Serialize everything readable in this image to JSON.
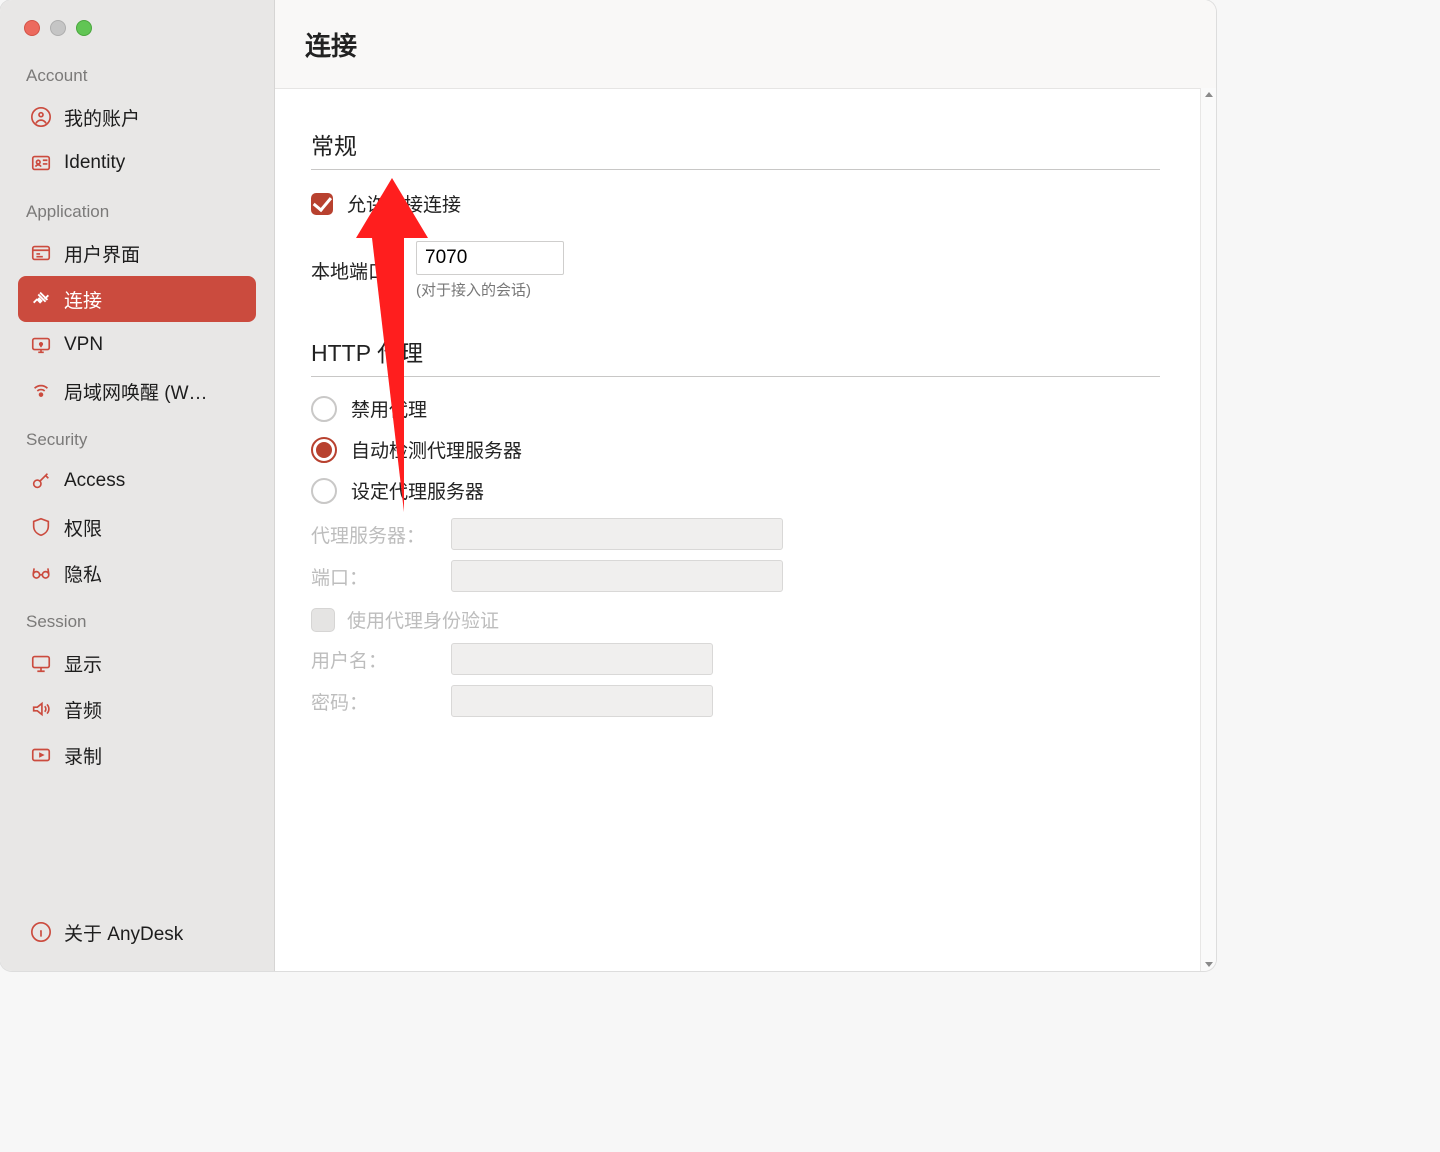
{
  "sidebar": {
    "sections": {
      "account": {
        "header": "Account",
        "items": [
          {
            "label": "我的账户",
            "icon": "user-circle"
          },
          {
            "label": "Identity",
            "icon": "id-card"
          }
        ]
      },
      "application": {
        "header": "Application",
        "items": [
          {
            "label": "用户界面",
            "icon": "ui"
          },
          {
            "label": "连接",
            "icon": "plug",
            "selected": true
          },
          {
            "label": "VPN",
            "icon": "vpn"
          },
          {
            "label": "局域网唤醒 (W…",
            "icon": "wol"
          }
        ]
      },
      "security": {
        "header": "Security",
        "items": [
          {
            "label": "Access",
            "icon": "key"
          },
          {
            "label": "权限",
            "icon": "shield"
          },
          {
            "label": "隐私",
            "icon": "glasses"
          }
        ]
      },
      "session": {
        "header": "Session",
        "items": [
          {
            "label": "显示",
            "icon": "display"
          },
          {
            "label": "音频",
            "icon": "audio"
          },
          {
            "label": "录制",
            "icon": "record"
          }
        ]
      }
    },
    "about": {
      "label": "关于 AnyDesk",
      "icon": "info"
    }
  },
  "main": {
    "title": "连接",
    "general": {
      "heading": "常规",
      "allow_direct_label": "允许直接连接",
      "allow_direct_checked": true,
      "local_port_label": "本地端口：",
      "local_port_value": "7070",
      "local_port_hint": "(对于接入的会话)"
    },
    "proxy": {
      "heading": "HTTP 代理",
      "options": {
        "disable": "禁用代理",
        "auto": "自动检测代理服务器",
        "manual": "设定代理服务器"
      },
      "selected": "auto",
      "server_label": "代理服务器：",
      "port_label": "端口：",
      "auth_checkbox_label": "使用代理身份验证",
      "user_label": "用户名：",
      "pass_label": "密码："
    }
  }
}
